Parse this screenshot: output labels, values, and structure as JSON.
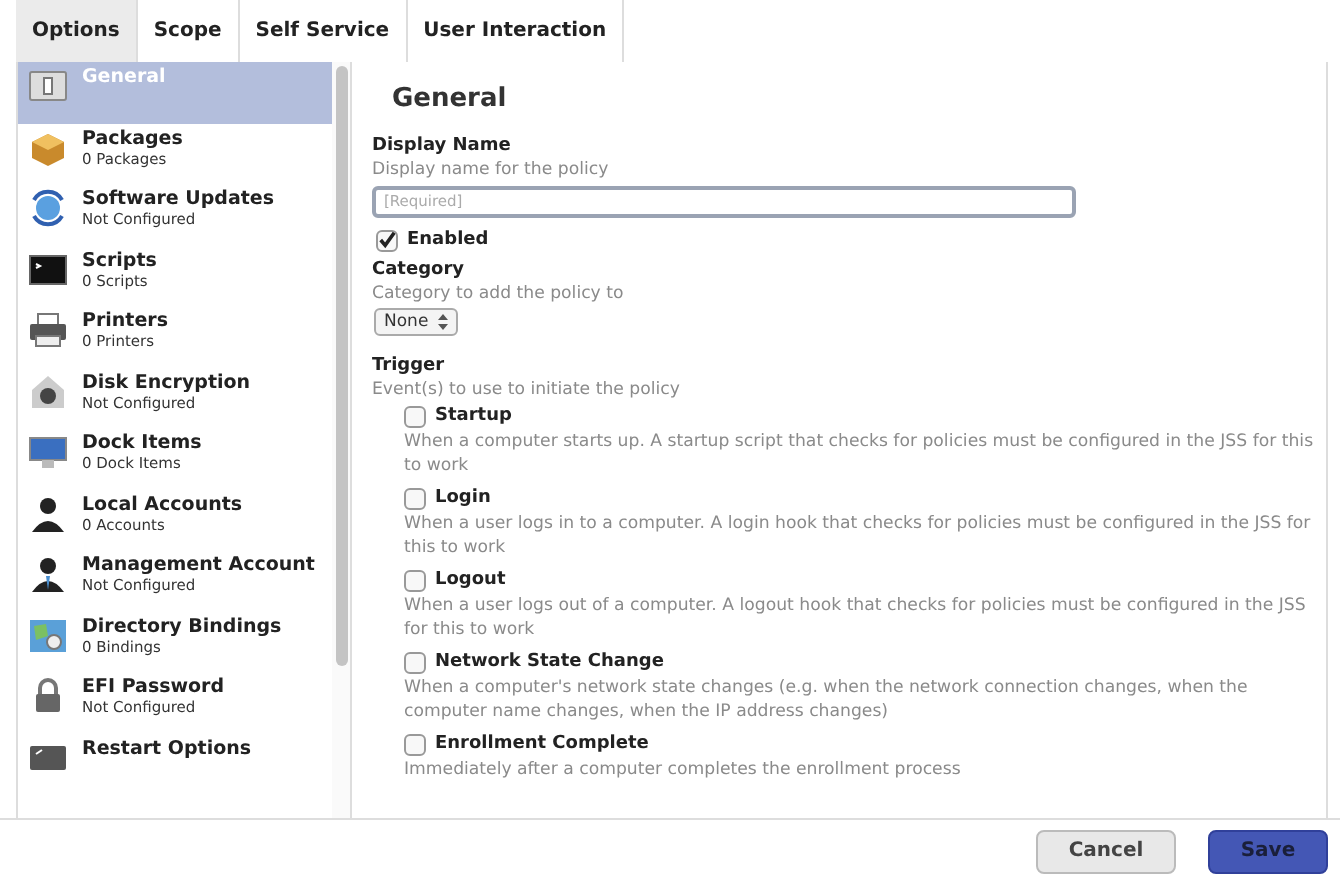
{
  "tabs": [
    {
      "label": "Options",
      "selected": true
    },
    {
      "label": "Scope",
      "selected": false
    },
    {
      "label": "Self Service",
      "selected": false
    },
    {
      "label": "User Interaction",
      "selected": false
    }
  ],
  "sidebar": {
    "items": [
      {
        "title": "General",
        "selected": true
      },
      {
        "title": "Packages",
        "subtitle": "0 Packages",
        "selected": false
      },
      {
        "title": "Software Updates",
        "subtitle": "Not Configured",
        "selected": false
      },
      {
        "title": "Scripts",
        "subtitle": "0 Scripts",
        "selected": false
      },
      {
        "title": "Printers",
        "subtitle": "0 Printers",
        "selected": false
      },
      {
        "title": "Disk Encryption",
        "subtitle": "Not Configured",
        "selected": false
      },
      {
        "title": "Dock Items",
        "subtitle": "0 Dock Items",
        "selected": false
      },
      {
        "title": "Local Accounts",
        "subtitle": "0 Accounts",
        "selected": false
      },
      {
        "title": "Management Account",
        "subtitle": "Not Configured",
        "selected": false
      },
      {
        "title": "Directory Bindings",
        "subtitle": "0 Bindings",
        "selected": false
      },
      {
        "title": "EFI Password",
        "subtitle": "Not Configured",
        "selected": false
      },
      {
        "title": "Restart Options",
        "selected": false
      }
    ]
  },
  "panel": {
    "heading": "General",
    "display_name": {
      "label": "Display Name",
      "hint": "Display name for the policy",
      "placeholder": "[Required]"
    },
    "enabled": {
      "label": "Enabled",
      "checked": true
    },
    "category": {
      "label": "Category",
      "hint": "Category to add the policy to",
      "value": "None"
    },
    "trigger": {
      "label": "Trigger",
      "hint": "Event(s) to use to initiate the policy",
      "events": [
        {
          "label": "Startup",
          "checked": false,
          "description": "When a computer starts up. A startup script that checks for policies must be configured in the JSS for this to work"
        },
        {
          "label": "Login",
          "checked": false,
          "description": "When a user logs in to a computer. A login hook that checks for policies must be configured in the JSS for this to work"
        },
        {
          "label": "Logout",
          "checked": false,
          "description": "When a user logs out of a computer. A logout hook that checks for policies must be configured in the JSS for this to work"
        },
        {
          "label": "Network State Change",
          "checked": false,
          "description": "When a computer's network state changes (e.g. when the network connection changes, when the computer name changes, when the IP address changes)"
        },
        {
          "label": "Enrollment Complete",
          "checked": false,
          "description": "Immediately after a computer completes the enrollment process"
        }
      ]
    }
  },
  "buttons": [
    {
      "label": "Cancel",
      "kind": "secondary"
    },
    {
      "label": "Save",
      "kind": "primary"
    }
  ]
}
